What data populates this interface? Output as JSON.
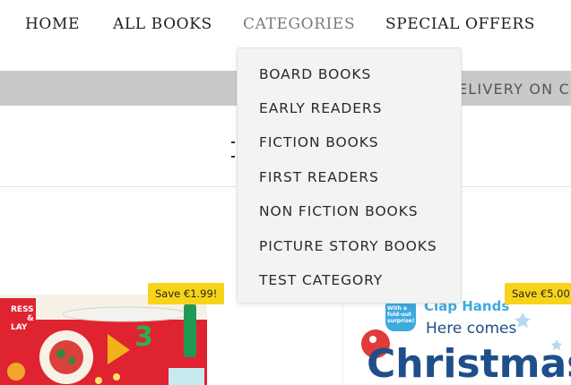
{
  "nav": {
    "items": [
      {
        "label": "HOME"
      },
      {
        "label": "ALL BOOKS"
      },
      {
        "label": "CATEGORIES"
      },
      {
        "label": "SPECIAL OFFERS"
      }
    ]
  },
  "announcement": {
    "text": "ELIVERY ON C"
  },
  "categories_menu": {
    "items": [
      {
        "label": "BOARD BOOKS"
      },
      {
        "label": "EARLY READERS"
      },
      {
        "label": "FICTION BOOKS"
      },
      {
        "label": "FIRST READERS"
      },
      {
        "label": "NON FICTION BOOKS"
      },
      {
        "label": "PICTURE STORY BOOKS"
      },
      {
        "label": "TEST CATEGORY"
      }
    ]
  },
  "products": [
    {
      "badge": "Save €1.99!",
      "cover_text_1": "RESS",
      "cover_text_2": "&",
      "cover_text_3": "LAY",
      "cover_digit": "3"
    },
    {
      "badge": "Save €5.00",
      "cover_bubble": "With a fold-out surprise!",
      "cover_text_1": "Clap Hands",
      "cover_text_2": "Here comes",
      "cover_text_3": "Christmas"
    }
  ],
  "colors": {
    "band": "#c9c9c9",
    "dropdown_bg": "#f3f3f3",
    "badge": "#f7d41a",
    "card1_cover": "#e02330",
    "title_blue": "#1e4f8a"
  }
}
